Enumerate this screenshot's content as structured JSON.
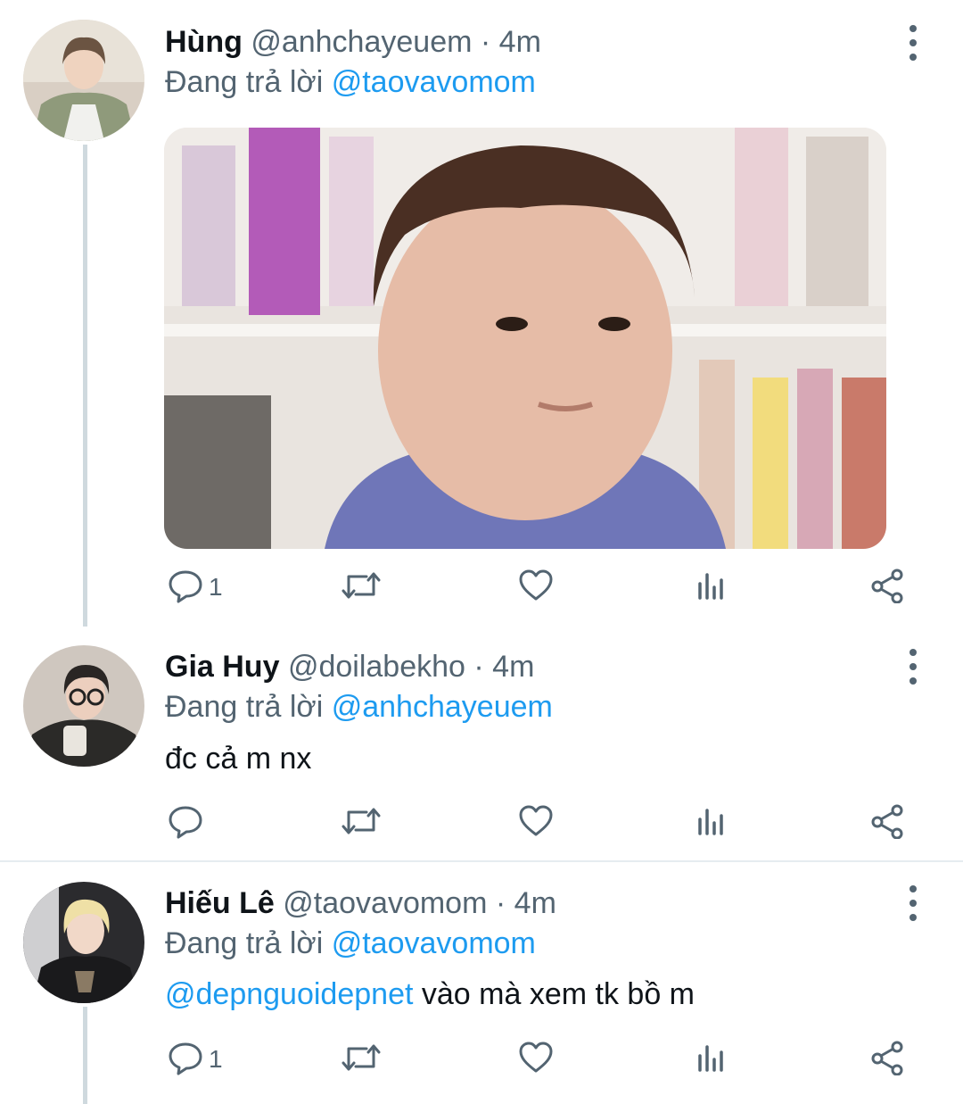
{
  "tweets": [
    {
      "name": "Hùng",
      "handle": "@anhchayeuem",
      "separator": "·",
      "time": "4m",
      "replying_prefix": "Đang trả lời",
      "replying_to": "@taovavomom",
      "has_media": true,
      "reply_count": "1"
    },
    {
      "name": "Gia Huy",
      "handle": "@doilabekho",
      "separator": "·",
      "time": "4m",
      "replying_prefix": "Đang trả lời",
      "replying_to": "@anhchayeuem",
      "text": "đc cả m nx",
      "reply_count": ""
    },
    {
      "name": "Hiếu Lê",
      "handle": "@taovavomom",
      "separator": "·",
      "time": "4m",
      "replying_prefix": "Đang trả lời",
      "replying_to": "@taovavomom",
      "text_mention": "@depnguoidepnet",
      "text": "vào mà xem tk bồ m",
      "reply_count": "1"
    }
  ],
  "colors": {
    "link": "#1d9bf0",
    "muted": "#536471",
    "text": "#0f1419",
    "thread_line": "#cfd9de"
  },
  "icons": [
    "reply-icon",
    "retweet-icon",
    "like-icon",
    "analytics-icon",
    "share-icon",
    "more-options-icon"
  ]
}
